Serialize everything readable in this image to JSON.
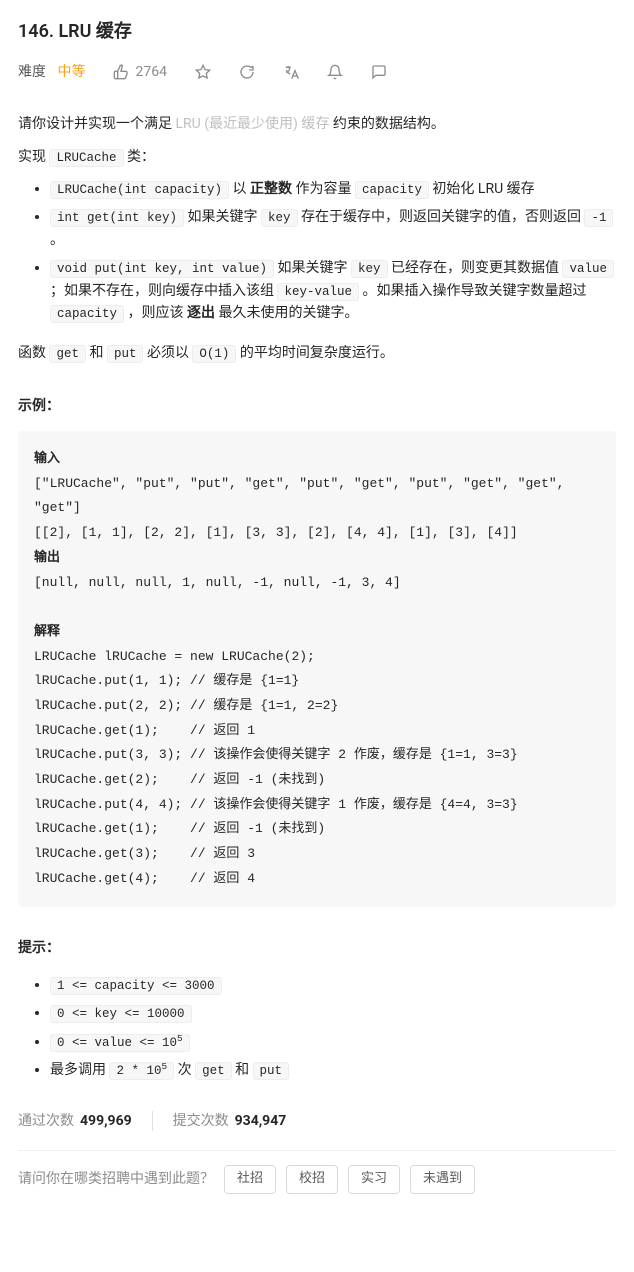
{
  "title": "146. LRU 缓存",
  "meta": {
    "difficulty_label": "难度",
    "difficulty_value": "中等",
    "likes": "2764"
  },
  "intro": {
    "prefix": "请你设计并实现一个满足 ",
    "gray_link": " LRU (最近最少使用) 缓存 ",
    "suffix": "约束的数据结构。"
  },
  "impl_line": {
    "prefix": "实现 ",
    "code": "LRUCache",
    "suffix": " 类："
  },
  "bullets": {
    "item1": {
      "code1": "LRUCache(int capacity)",
      "mid": " 以 ",
      "bold": "正整数",
      "mid2": " 作为容量 ",
      "code2": "capacity",
      "suffix": " 初始化 LRU 缓存"
    },
    "item2": {
      "code1": "int get(int key)",
      "mid1": " 如果关键字 ",
      "code2": "key",
      "mid2": " 存在于缓存中，则返回关键字的值，否则返回 ",
      "code3": "-1",
      "suffix": " 。"
    },
    "item3": {
      "code1": "void put(int key, int value)",
      "mid1": " 如果关键字 ",
      "code2": "key",
      "mid2": " 已经存在，则变更其数据值 ",
      "code3": "value",
      "mid3": " ；如果不存在，则向缓存中插入该组 ",
      "code4": "key-value",
      "mid4": " 。如果插入操作导致关键字数量超过 ",
      "code5": "capacity",
      "mid5": " ，则应该 ",
      "bold": "逐出",
      "suffix": " 最久未使用的关键字。"
    }
  },
  "func_line": {
    "t1": "函数 ",
    "c1": "get",
    "t2": " 和 ",
    "c2": "put",
    "t3": " 必须以 ",
    "c3": "O(1)",
    "t4": " 的平均时间复杂度运行。"
  },
  "example_label": "示例：",
  "example": {
    "input_label": "输入",
    "input_line1": "[\"LRUCache\", \"put\", \"put\", \"get\", \"put\", \"get\", \"put\", \"get\", \"get\", \"get\"]",
    "input_line2": "[[2], [1, 1], [2, 2], [1], [3, 3], [2], [4, 4], [1], [3], [4]]",
    "output_label": "输出",
    "output_line": "[null, null, null, 1, null, -1, null, -1, 3, 4]",
    "explain_label": "解释",
    "l1": "LRUCache lRUCache = new LRUCache(2);",
    "l2": "lRUCache.put(1, 1); // 缓存是 {1=1}",
    "l3": "lRUCache.put(2, 2); // 缓存是 {1=1, 2=2}",
    "l4": "lRUCache.get(1);    // 返回 1",
    "l5": "lRUCache.put(3, 3); // 该操作会使得关键字 2 作废，缓存是 {1=1, 3=3}",
    "l6": "lRUCache.get(2);    // 返回 -1 (未找到)",
    "l7": "lRUCache.put(4, 4); // 该操作会使得关键字 1 作废，缓存是 {4=4, 3=3}",
    "l8": "lRUCache.get(1);    // 返回 -1 (未找到)",
    "l9": "lRUCache.get(3);    // 返回 3",
    "l10": "lRUCache.get(4);    // 返回 4"
  },
  "hints_label": "提示：",
  "hints": {
    "h1": "1 <= capacity <= 3000",
    "h2": "0 <= key <= 10000",
    "h3_pre": "0 <= value <= 10",
    "h3_sup": "5",
    "h4_pre": "最多调用 ",
    "h4_code_pre": "2 * 10",
    "h4_sup": "5",
    "h4_mid": " 次 ",
    "h4_c1": "get",
    "h4_mid2": " 和 ",
    "h4_c2": "put"
  },
  "stats": {
    "pass_label": "通过次数",
    "pass_value": "499,969",
    "submit_label": "提交次数",
    "submit_value": "934,947"
  },
  "bottom": {
    "question": "请问你在哪类招聘中遇到此题？",
    "b1": "社招",
    "b2": "校招",
    "b3": "实习",
    "b4": "未遇到"
  }
}
